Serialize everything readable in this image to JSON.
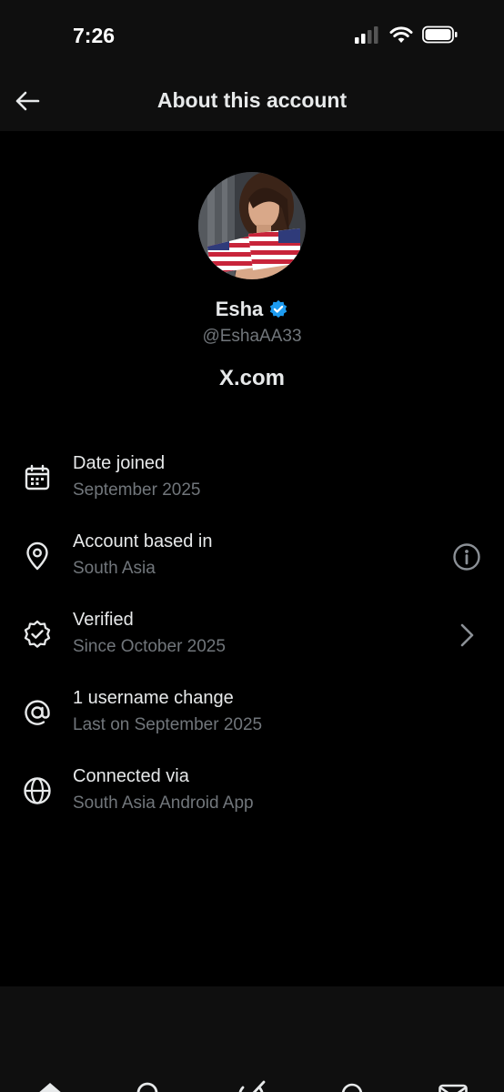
{
  "status_bar": {
    "time": "7:26"
  },
  "header": {
    "title": "About this account"
  },
  "profile": {
    "name": "Esha",
    "handle": "@EshaAA33",
    "domain": "X.com",
    "verified_color": "#1d9bf0"
  },
  "info": [
    {
      "icon": "calendar-icon",
      "title": "Date joined",
      "subtitle": "September 2025",
      "action": null
    },
    {
      "icon": "location-pin-icon",
      "title": "Account based in",
      "subtitle": "South Asia",
      "action": "info-icon"
    },
    {
      "icon": "verified-badge-icon",
      "title": "Verified",
      "subtitle": "Since October 2025",
      "action": "chevron-right-icon"
    },
    {
      "icon": "at-sign-icon",
      "title": "1 username change",
      "subtitle": "Last on September 2025",
      "action": null
    },
    {
      "icon": "globe-icon",
      "title": "Connected via",
      "subtitle": "South Asia Android App",
      "action": null
    }
  ],
  "bottom_nav": [
    "home-icon",
    "search-icon",
    "grok-icon",
    "notifications-icon",
    "messages-icon"
  ],
  "colors": {
    "background": "#000000",
    "secondary_text": "#71767b",
    "primary_text": "#e7e9ea"
  }
}
